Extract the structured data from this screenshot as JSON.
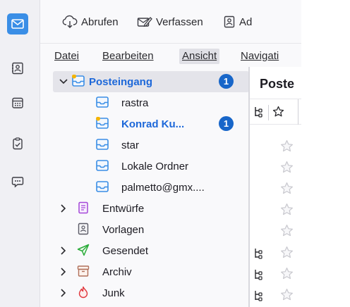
{
  "toolbar": {
    "get_messages": "Abrufen",
    "write": "Verfassen",
    "address_book_partial": "Ad"
  },
  "menubar": {
    "items": [
      "Datei",
      "Bearbeiten",
      "Ansicht",
      "Navigati"
    ]
  },
  "folders": {
    "items": [
      {
        "label": "Posteingang",
        "level": 0,
        "bold": true,
        "badge": "1",
        "expanded": true,
        "icon": "inbox-icon"
      },
      {
        "label": "rastra",
        "level": 1,
        "bold": false,
        "icon": "inbox-icon"
      },
      {
        "label": "Konrad Ku...",
        "level": 1,
        "bold": true,
        "badge": "1",
        "icon": "inbox-icon"
      },
      {
        "label": "star",
        "level": 1,
        "bold": false,
        "icon": "inbox-icon"
      },
      {
        "label": "Lokale Ordner",
        "level": 1,
        "bold": false,
        "icon": "inbox-icon"
      },
      {
        "label": "palmetto@gmx....",
        "level": 1,
        "bold": false,
        "icon": "inbox-icon"
      },
      {
        "label": "Entwürfe",
        "level": 0,
        "bold": false,
        "icon": "drafts-icon"
      },
      {
        "label": "Vorlagen",
        "level": 0,
        "bold": false,
        "icon": "templates-icon"
      },
      {
        "label": "Gesendet",
        "level": 0,
        "bold": false,
        "icon": "sent-icon"
      },
      {
        "label": "Archiv",
        "level": 0,
        "bold": false,
        "icon": "archive-icon"
      },
      {
        "label": "Junk",
        "level": 0,
        "bold": false,
        "icon": "junk-icon"
      }
    ]
  },
  "message_list": {
    "title": "Poste"
  },
  "colors": {
    "accent": "#3a8ee6",
    "unread_badge": "#1866c9",
    "bold_folder": "#1d68d9",
    "new_mail_dot": "#f5b400"
  }
}
